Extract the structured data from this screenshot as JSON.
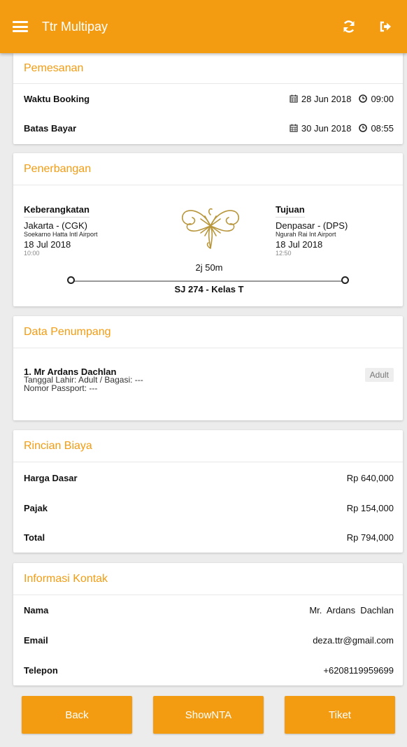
{
  "app": {
    "title": "Ttr Multipay",
    "accent_color": "#f39c12"
  },
  "header_icons": {
    "menu": "hamburger-icon",
    "refresh": "refresh-icon",
    "logout": "sign-out-icon"
  },
  "pemesanan": {
    "title": "Pemesanan",
    "waktu_booking": {
      "label": "Waktu Booking",
      "date": "28 Jun 2018",
      "time": "09:00"
    },
    "batas_bayar": {
      "label": "Batas Bayar",
      "date": "30 Jun 2018",
      "time": "08:55"
    }
  },
  "penerbangan": {
    "title": "Penerbangan",
    "departure": {
      "label": "Keberangkatan",
      "city": "Jakarta - (CGK)",
      "airport": "Soekarno Hatta Intl Airport",
      "date": "18 Jul 2018",
      "time": "10:00"
    },
    "arrival": {
      "label": "Tujuan",
      "city": "Denpasar - (DPS)",
      "airport": "Ngurah Rai Int Airport",
      "date": "18 Jul 2018",
      "time": "12:50"
    },
    "duration": "2j 50m",
    "flight_number": "SJ 274 -  Kelas T"
  },
  "penumpang": {
    "title": "Data Penumpang",
    "passengers": [
      {
        "name": "1. Mr Ardans Dachlan",
        "line1": "Tanggal Lahir: Adult / Bagasi: ---",
        "line2": "Nomor Passport: ---",
        "type": "Adult"
      }
    ]
  },
  "biaya": {
    "title": "Rincian Biaya",
    "rows": [
      {
        "label": "Harga Dasar",
        "value": "Rp 640,000"
      },
      {
        "label": "Pajak",
        "value": "Rp 154,000"
      },
      {
        "label": "Total",
        "value": "Rp 794,000"
      }
    ]
  },
  "kontak": {
    "title": "Informasi Kontak",
    "rows": [
      {
        "label": "Nama",
        "value": "Mr.  Ardans  Dachlan"
      },
      {
        "label": "Email",
        "value": "deza.ttr@gmail.com"
      },
      {
        "label": "Telepon",
        "value": "+6208119959699"
      }
    ]
  },
  "buttons": {
    "back": "Back",
    "show_nta": "ShowNTA",
    "tiket": "Tiket"
  }
}
